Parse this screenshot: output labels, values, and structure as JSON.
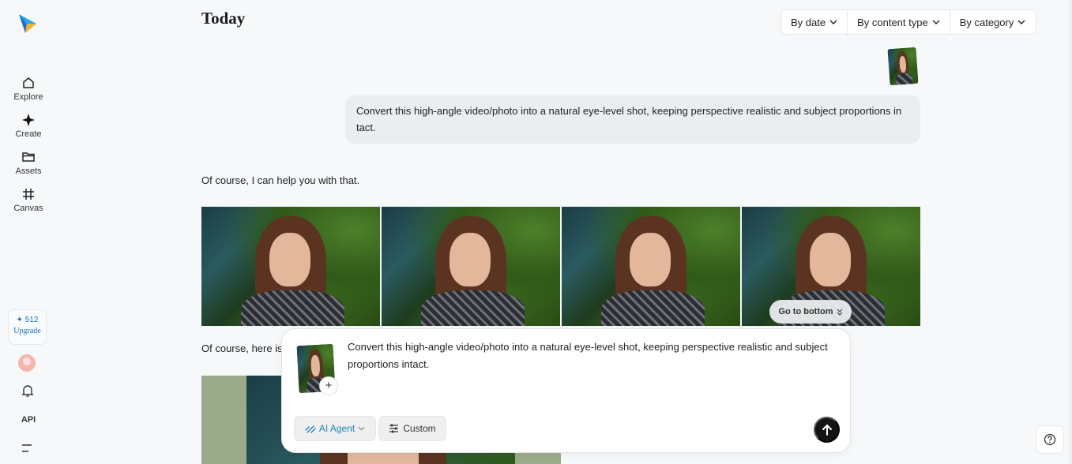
{
  "sidebar": {
    "items": [
      {
        "label": "Explore",
        "icon": "home-icon"
      },
      {
        "label": "Create",
        "icon": "sparkle-icon"
      },
      {
        "label": "Assets",
        "icon": "folder-icon"
      },
      {
        "label": "Canvas",
        "icon": "frame-icon"
      }
    ],
    "credits": "512",
    "upgrade": "Upgrade",
    "api": "API"
  },
  "header": {
    "title": "Today",
    "filters": [
      "By date",
      "By content type",
      "By category"
    ]
  },
  "chat": {
    "user_message": "Convert this high-angle video/photo into a natural eye-level shot, keeping perspective realistic and subject proportions in tact.",
    "reply_1": "Of course, I can help you with that.",
    "reply_2": "Of course, here is",
    "go_to_bottom": "Go to bottom"
  },
  "composer": {
    "text": "Convert this high-angle video/photo into a natural eye-level shot, keeping perspective realistic and subject proportions intact.",
    "agent_label": "AI Agent",
    "custom_label": "Custom",
    "plus": "+"
  },
  "colors": {
    "accent": "#1b87b8",
    "bubble": "#ebedf0",
    "send": "#141414"
  }
}
